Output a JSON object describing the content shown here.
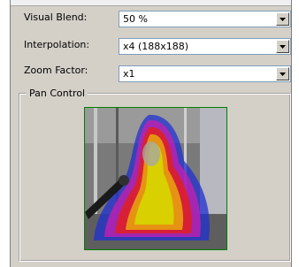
{
  "settings": {
    "visual_blend": {
      "label": "Visual Blend:",
      "value": "50 %"
    },
    "interpolation": {
      "label": "Interpolation:",
      "value": "x4 (188x188)"
    },
    "zoom_factor": {
      "label": "Zoom Factor:",
      "value": "x1"
    }
  },
  "pan_control": {
    "title": "Pan Control",
    "frame_color": "#008000"
  },
  "icons": {
    "dropdown": "chevron-down-icon"
  },
  "colors": {
    "panel_bg": "#d4d0c8",
    "field_border": "#7f9db9"
  }
}
